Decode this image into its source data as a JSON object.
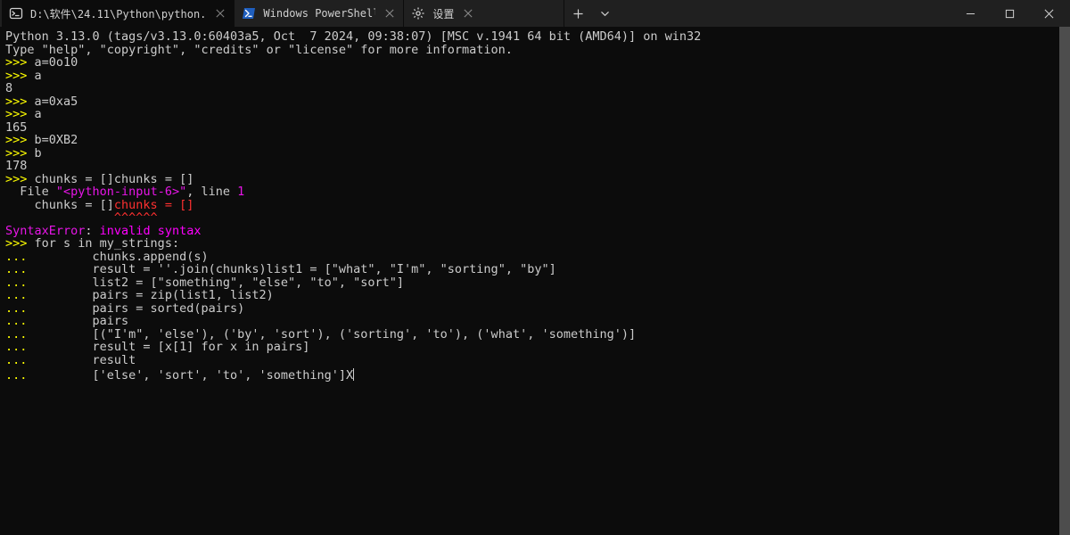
{
  "tabs": [
    {
      "label": "D:\\软件\\24.11\\Python\\python.",
      "icon": "terminal-icon",
      "active": true
    },
    {
      "label": "Windows PowerShell",
      "icon": "powershell-icon",
      "active": false
    },
    {
      "label": "设置",
      "icon": "settings-icon",
      "active": false
    }
  ],
  "titlebar": {
    "new_tab_tooltip": "New tab",
    "dropdown_tooltip": "Tab dropdown"
  },
  "terminal": {
    "lines": [
      [
        {
          "t": "Python 3.13.0 (tags/v3.13.0:60403a5, Oct  7 2024, 09:38:07) [MSC v.1941 64 bit (AMD64)] on win32",
          "c": "white"
        }
      ],
      [
        {
          "t": "Type \"help\", \"copyright\", \"credits\" or \"license\" for more information.",
          "c": "white"
        }
      ],
      [
        {
          "t": ">>> ",
          "c": "yellow"
        },
        {
          "t": "a=0o10",
          "c": "white"
        }
      ],
      [
        {
          "t": ">>> ",
          "c": "yellow"
        },
        {
          "t": "a",
          "c": "white"
        }
      ],
      [
        {
          "t": "8",
          "c": "white"
        }
      ],
      [
        {
          "t": ">>> ",
          "c": "yellow"
        },
        {
          "t": "a=0xa5",
          "c": "white"
        }
      ],
      [
        {
          "t": ">>> ",
          "c": "yellow"
        },
        {
          "t": "a",
          "c": "white"
        }
      ],
      [
        {
          "t": "165",
          "c": "white"
        }
      ],
      [
        {
          "t": ">>> ",
          "c": "yellow"
        },
        {
          "t": "b=0XB2",
          "c": "white"
        }
      ],
      [
        {
          "t": ">>> ",
          "c": "yellow"
        },
        {
          "t": "b",
          "c": "white"
        }
      ],
      [
        {
          "t": "178",
          "c": "white"
        }
      ],
      [
        {
          "t": ">>> ",
          "c": "yellow"
        },
        {
          "t": "chunks = []chunks = []",
          "c": "white"
        }
      ],
      [
        {
          "t": "  File ",
          "c": "white"
        },
        {
          "t": "\"<python-input-6>\"",
          "c": "magenta"
        },
        {
          "t": ", line ",
          "c": "white"
        },
        {
          "t": "1",
          "c": "magenta"
        }
      ],
      [
        {
          "t": "    chunks = []",
          "c": "white"
        },
        {
          "t": "chunks = []",
          "c": "red"
        }
      ],
      [
        {
          "t": "               ",
          "c": "white"
        },
        {
          "t": "^^^^^^",
          "c": "red"
        }
      ],
      [
        {
          "t": "SyntaxError",
          "c": "magenta"
        },
        {
          "t": ": ",
          "c": "white"
        },
        {
          "t": "invalid syntax",
          "c": "brightmagenta"
        }
      ],
      [
        {
          "t": ">>> ",
          "c": "yellow"
        },
        {
          "t": "for s in my_strings:",
          "c": "white"
        }
      ],
      [
        {
          "t": "... ",
          "c": "yellow"
        },
        {
          "t": "        chunks.append(s)",
          "c": "white"
        }
      ],
      [
        {
          "t": "... ",
          "c": "yellow"
        },
        {
          "t": "        result = ''.join(chunks)list1 = [\"what\", \"I'm\", \"sorting\", \"by\"]",
          "c": "white"
        }
      ],
      [
        {
          "t": "... ",
          "c": "yellow"
        },
        {
          "t": "        list2 = [\"something\", \"else\", \"to\", \"sort\"]",
          "c": "white"
        }
      ],
      [
        {
          "t": "... ",
          "c": "yellow"
        },
        {
          "t": "        pairs = zip(list1, list2)",
          "c": "white"
        }
      ],
      [
        {
          "t": "... ",
          "c": "yellow"
        },
        {
          "t": "        pairs = sorted(pairs)",
          "c": "white"
        }
      ],
      [
        {
          "t": "... ",
          "c": "yellow"
        },
        {
          "t": "        pairs",
          "c": "white"
        }
      ],
      [
        {
          "t": "... ",
          "c": "yellow"
        },
        {
          "t": "        [(\"I'm\", 'else'), ('by', 'sort'), ('sorting', 'to'), ('what', 'something')]",
          "c": "white"
        }
      ],
      [
        {
          "t": "... ",
          "c": "yellow"
        },
        {
          "t": "        result = [x[1] for x in pairs]",
          "c": "white"
        }
      ],
      [
        {
          "t": "... ",
          "c": "yellow"
        },
        {
          "t": "        result",
          "c": "white"
        }
      ],
      [
        {
          "t": "... ",
          "c": "yellow"
        },
        {
          "t": "        ['else', 'sort', 'to', 'something']X",
          "c": "white",
          "cursor": true
        }
      ]
    ]
  },
  "scrollbar": {
    "track_height": 570,
    "thumb_top": 0,
    "thumb_height": 570
  }
}
